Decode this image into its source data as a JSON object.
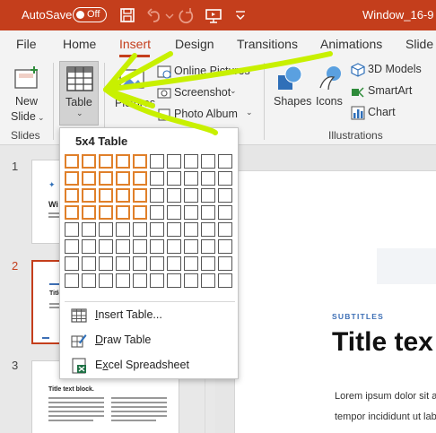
{
  "titlebar": {
    "autosave_label": "AutoSave",
    "autosave_state": "Off",
    "document_name": "Window_16-9"
  },
  "tabs": [
    {
      "label": "File"
    },
    {
      "label": "Home"
    },
    {
      "label": "Insert"
    },
    {
      "label": "Design"
    },
    {
      "label": "Transitions"
    },
    {
      "label": "Animations"
    },
    {
      "label": "Slide S"
    }
  ],
  "ribbon": {
    "new_slide": "New",
    "new_slide_2": "Slide",
    "table": "Table",
    "pictures": "Pictures",
    "online_pictures": "Online Pictures",
    "screenshot": "Screenshot",
    "photo_album": "Photo Album",
    "shapes": "Shapes",
    "icons": "Icons",
    "models_3d": "3D Models",
    "smartart": "SmartArt",
    "chart": "Chart",
    "group_slides": "Slides",
    "group_illustrations": "Illustrations"
  },
  "dropdown": {
    "title": "5x4 Table",
    "grid_cols": 10,
    "grid_rows": 8,
    "selected_cols": 5,
    "selected_rows": 4,
    "items": [
      {
        "label": "Insert Table...",
        "underline": "I",
        "rest": "nsert Table...",
        "icon": "table-grid-icon"
      },
      {
        "label": "Draw Table",
        "underline": "D",
        "rest": "raw Table",
        "icon": "pencil-icon"
      },
      {
        "label": "Excel Spreadsheet",
        "underline": "X",
        "rest": "Excel Spreadsheet",
        "icon": "excel-icon"
      }
    ]
  },
  "thumbnails": [
    {
      "number": "1",
      "title": "Wi"
    },
    {
      "number": "2",
      "title": "Title"
    },
    {
      "number": "3",
      "title": "Title text block."
    }
  ],
  "slide": {
    "subtitle": "SUBTITLES",
    "title": "Title tex",
    "body_line_1": "Lorem ipsum dolor sit a",
    "body_line_2": "tempor incididunt ut labo"
  },
  "colors": {
    "brand": "#c43e1c",
    "selection": "#e0802a",
    "annotation": "#c8f000",
    "accent_blue": "#3d6fb5"
  }
}
